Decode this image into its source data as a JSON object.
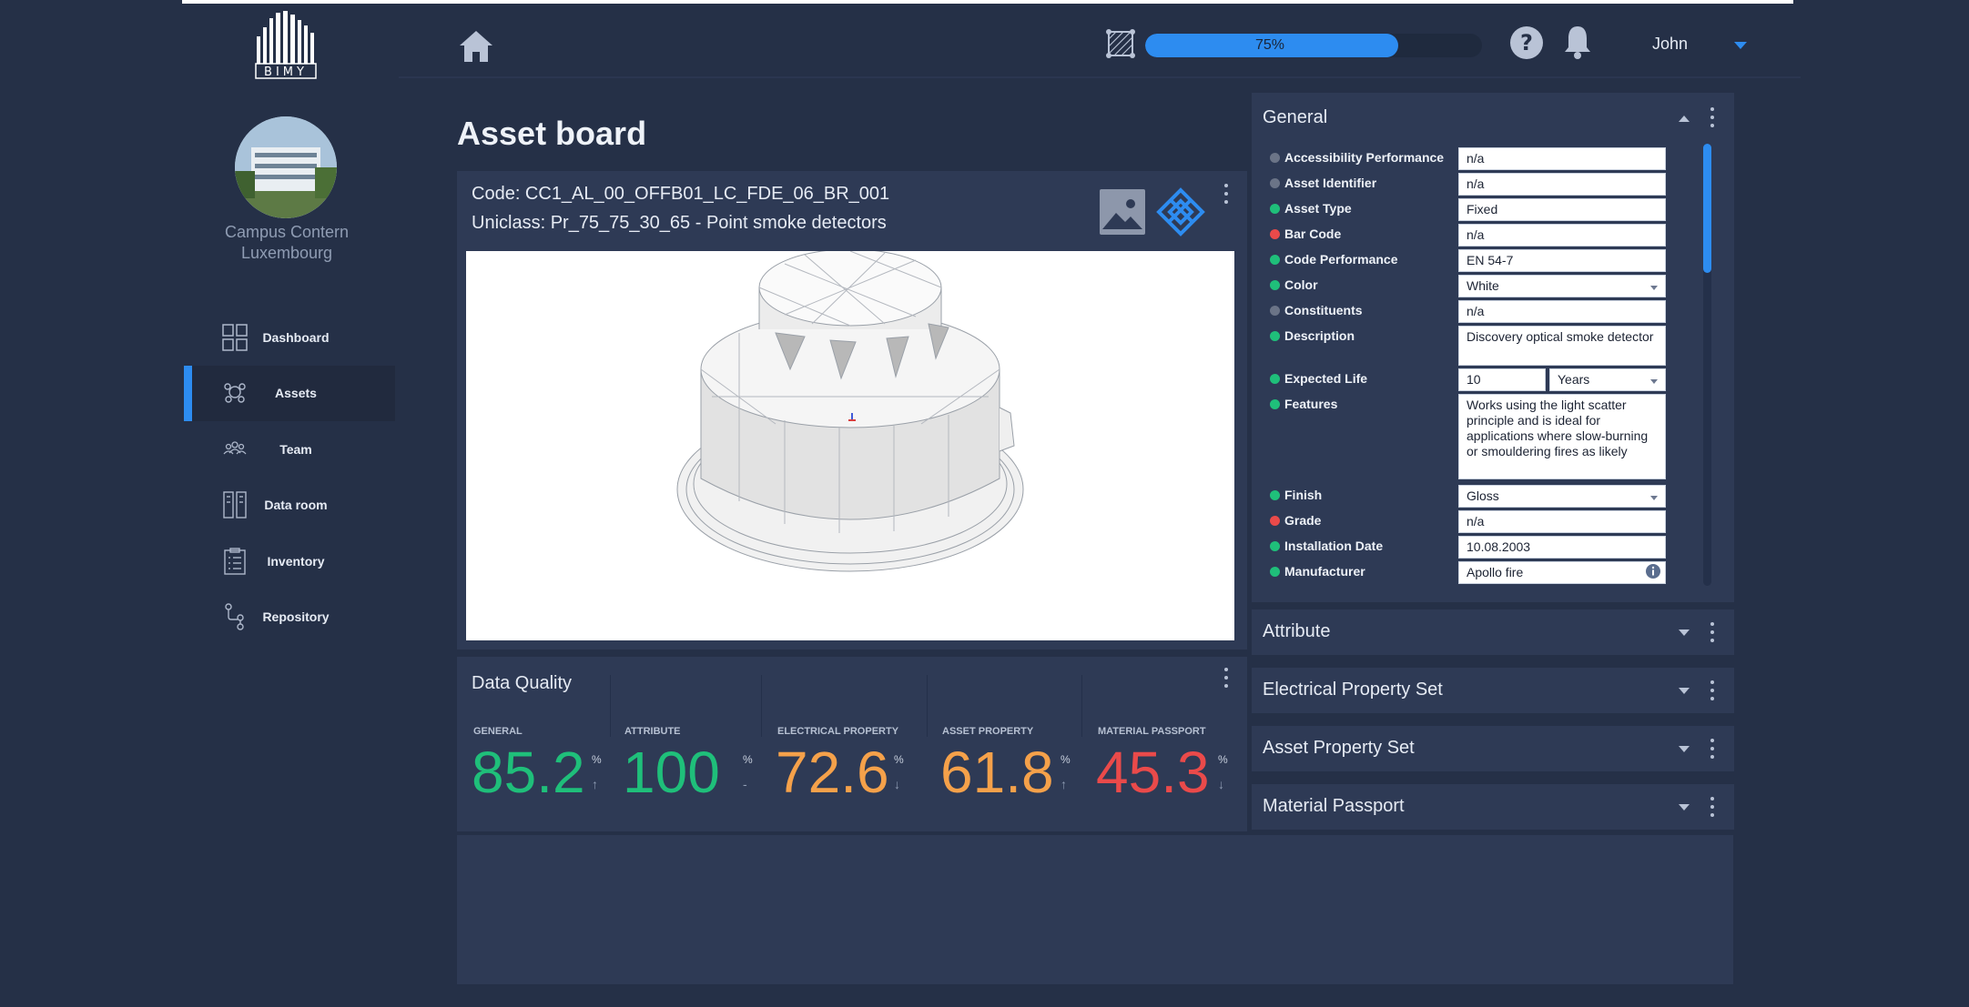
{
  "colors": {
    "accent": "#2d8cf0",
    "good": "#1fbf7a",
    "warn": "#f5a14a",
    "bad": "#ea4a4a",
    "neutral": "#6b7487"
  },
  "sidebar": {
    "site_name_line1": "Campus Contern",
    "site_name_line2": "Luxembourg",
    "items": [
      {
        "label": "Dashboard",
        "icon": "dashboard-icon"
      },
      {
        "label": "Assets",
        "icon": "assets-icon",
        "active": true
      },
      {
        "label": "Team",
        "icon": "team-icon"
      },
      {
        "label": "Data room",
        "icon": "data-room-icon"
      },
      {
        "label": "Inventory",
        "icon": "inventory-icon"
      },
      {
        "label": "Repository",
        "icon": "repository-icon"
      }
    ]
  },
  "header": {
    "progress_label": "75%",
    "progress": 0.75,
    "user_name": "John"
  },
  "main": {
    "title": "Asset board",
    "code_line": "Code: CC1_AL_00_OFFB01_LC_FDE_06_BR_001",
    "uniclass_line": "Uniclass: Pr_75_75_30_65 - Point smoke detectors"
  },
  "data_quality": {
    "title": "Data Quality",
    "metrics": [
      {
        "label": "GENERAL",
        "value": "85.2",
        "unit": "%",
        "trend": "↑",
        "color": "#1fbf7a"
      },
      {
        "label": "ATTRIBUTE",
        "value": "100",
        "unit": "%",
        "trend": "-",
        "color": "#1fbf7a"
      },
      {
        "label": "ELECTRICAL PROPERTY",
        "value": "72.6",
        "unit": "%",
        "trend": "↓",
        "color": "#f5a14a"
      },
      {
        "label": "ASSET PROPERTY",
        "value": "61.8",
        "unit": "%",
        "trend": "↑",
        "color": "#f5a14a"
      },
      {
        "label": "MATERIAL PASSPORT",
        "value": "45.3",
        "unit": "%",
        "trend": "↓",
        "color": "#ea4a4a"
      }
    ]
  },
  "general": {
    "title": "General",
    "rows": [
      {
        "name": "Accessibility Performance",
        "value": "n/a",
        "status": "neutral"
      },
      {
        "name": "Asset Identifier",
        "value": "n/a",
        "status": "neutral"
      },
      {
        "name": "Asset Type",
        "value": "Fixed",
        "status": "good"
      },
      {
        "name": "Bar Code",
        "value": "n/a",
        "status": "bad"
      },
      {
        "name": "Code Performance",
        "value": "EN 54-7",
        "status": "good"
      },
      {
        "name": "Color",
        "value": "White",
        "status": "good",
        "select": true
      },
      {
        "name": "Constituents",
        "value": "n/a",
        "status": "neutral"
      },
      {
        "name": "Description",
        "value": "Discovery optical smoke detector",
        "status": "good"
      },
      {
        "name": "Expected Life",
        "value": "10",
        "unit_value": "Years",
        "status": "good"
      },
      {
        "name": "Features",
        "value": "Works using the light scatter principle and is ideal for applications where slow-burning or smouldering fires as likely",
        "status": "good"
      },
      {
        "name": "Finish",
        "value": "Gloss",
        "status": "good",
        "select": true
      },
      {
        "name": "Grade",
        "value": "n/a",
        "status": "bad"
      },
      {
        "name": "Installation Date",
        "value": "10.08.2003",
        "status": "good"
      },
      {
        "name": "Manufacturer",
        "value": "Apollo fire",
        "status": "good",
        "info": true
      }
    ]
  },
  "accordions": [
    {
      "title": "Attribute"
    },
    {
      "title": "Electrical Property Set"
    },
    {
      "title": "Asset Property Set"
    },
    {
      "title": "Material Passport"
    }
  ]
}
